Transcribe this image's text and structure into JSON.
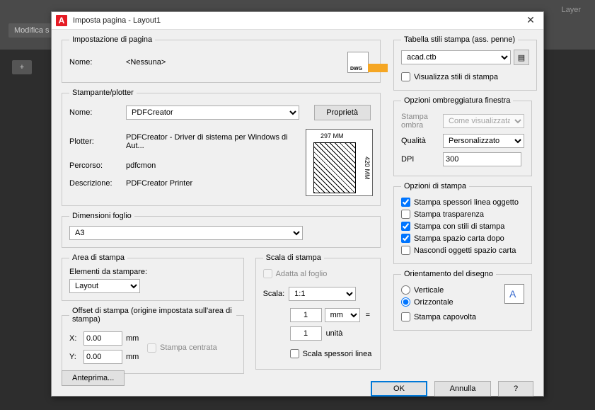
{
  "bg": {
    "tab": "Modifica s",
    "layer": "Layer",
    "plus": "+"
  },
  "titlebar": {
    "title": "Imposta pagina - Layout1",
    "close": "✕"
  },
  "pageSetup": {
    "legend": "Impostazione di pagina",
    "name_label": "Nome:",
    "name_value": "<Nessuna>"
  },
  "printer": {
    "legend": "Stampante/plotter",
    "name_label": "Nome:",
    "name_value": "PDFCreator",
    "props_btn": "Proprietà",
    "plotter_label": "Plotter:",
    "plotter_value": "PDFCreator - Driver di sistema per Windows di Aut...",
    "where_label": "Percorso:",
    "where_value": "pdfcmon",
    "desc_label": "Descrizione:",
    "desc_value": "PDFCreator Printer",
    "dim_w": "297 MM",
    "dim_h": "420 MM"
  },
  "paper": {
    "legend": "Dimensioni foglio",
    "value": "A3"
  },
  "area": {
    "legend": "Area di stampa",
    "elements_label": "Elementi da stampare:",
    "value": "Layout"
  },
  "offset": {
    "legend": "Offset di stampa (origine impostata sull'area di stampa)",
    "x_label": "X:",
    "y_label": "Y:",
    "x_value": "0.00",
    "y_value": "0.00",
    "unit": "mm",
    "center": "Stampa centrata"
  },
  "scale": {
    "legend": "Scala di stampa",
    "fit": "Adatta al foglio",
    "scale_label": "Scala:",
    "scale_value": "1:1",
    "num": "1",
    "num_unit": "mm",
    "den": "1",
    "den_unit": "unità",
    "lineweights": "Scala spessori linea",
    "eq": "="
  },
  "styles": {
    "legend": "Tabella stili stampa (ass. penne)",
    "value": "acad.ctb",
    "display": "Visualizza stili di stampa"
  },
  "shade": {
    "legend": "Opzioni ombreggiatura finestra",
    "shade_label": "Stampa ombra",
    "shade_value": "Come visualizzata",
    "quality_label": "Qualità",
    "quality_value": "Personalizzato",
    "dpi_label": "DPI",
    "dpi_value": "300"
  },
  "options": {
    "legend": "Opzioni di stampa",
    "lw": "Stampa spessori linea oggetto",
    "transparency": "Stampa trasparenza",
    "withstyles": "Stampa con stili di stampa",
    "paperspace": "Stampa spazio carta dopo",
    "hide": "Nascondi oggetti spazio carta"
  },
  "orient": {
    "legend": "Orientamento del disegno",
    "portrait": "Verticale",
    "landscape": "Orizzontale",
    "upside": "Stampa capovolta"
  },
  "buttons": {
    "preview": "Anteprima...",
    "ok": "OK",
    "cancel": "Annulla",
    "help": "?"
  }
}
